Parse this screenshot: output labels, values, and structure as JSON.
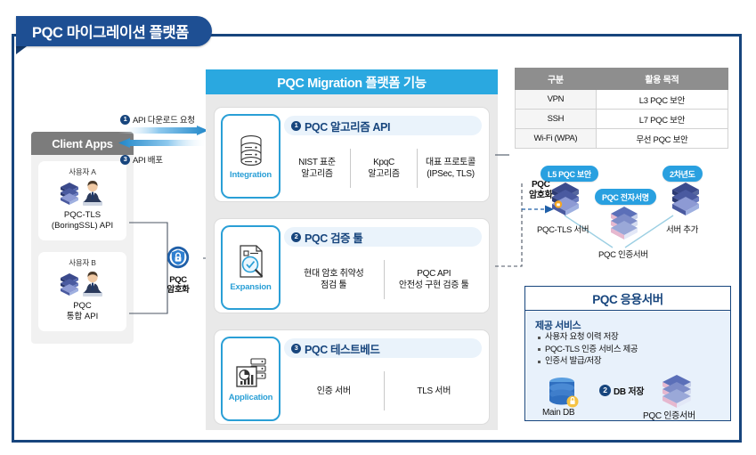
{
  "title": "PQC 마이그레이션 플랫폼",
  "client_apps": {
    "header": "Client Apps",
    "cards": [
      {
        "user": "사용자 A",
        "name_line1": "PQC-TLS",
        "name_line2": "(BoringSSL) API"
      },
      {
        "user": "사용자 B",
        "name_line1": "PQC",
        "name_line2": "통합 API"
      }
    ]
  },
  "flow_arrows": {
    "download_num": "1",
    "download_label": "API 다운로드 요청",
    "deploy_num": "3",
    "deploy_label": "API 배포"
  },
  "lock_node": {
    "icon": "lock-shield-icon",
    "line1": "PQC",
    "line2": "암호화"
  },
  "platform": {
    "header": "PQC Migration 플랫폼 기능",
    "features": [
      {
        "num": "1",
        "title": "PQC 알고리즘 API",
        "icon_caption": "Integration",
        "icon": "database-stack-icon",
        "columns": [
          {
            "line1": "NIST 표준",
            "line2": "알고리즘"
          },
          {
            "line1": "KpqC",
            "line2": "알고리즘"
          },
          {
            "line1": "대표 프로토콜",
            "line2": "(IPSec, TLS)"
          }
        ]
      },
      {
        "num": "2",
        "title": "PQC 검증 툴",
        "icon_caption": "Expansion",
        "icon": "document-magnifier-icon",
        "columns": [
          {
            "line1": "현대 암호 취약성",
            "line2": "점검 툴"
          },
          {
            "line1": "PQC API",
            "line2": "안전성 구현 검증 툴"
          }
        ]
      },
      {
        "num": "3",
        "title": "PQC 테스트베드",
        "icon_caption": "Application",
        "icon": "analytics-chart-icon",
        "columns": [
          {
            "line1": "인증 서버",
            "line2": ""
          },
          {
            "line1": "TLS 서버",
            "line2": ""
          }
        ]
      }
    ]
  },
  "usage_table": {
    "headers": [
      "구분",
      "활용 목적"
    ],
    "rows": [
      [
        "VPN",
        "L3 PQC 보안"
      ],
      [
        "SSH",
        "L7 PQC 보안"
      ],
      [
        "Wi-Fi (WPA)",
        "무선 PQC 보안"
      ]
    ]
  },
  "server_group": {
    "enc_line1": "PQC",
    "enc_line2": "암호화",
    "badge_l5": "L5 PQC 보안",
    "badge_sign": "PQC 전자서명",
    "badge_year2": "2차년도",
    "label_tls": "PQC-TLS 서버",
    "label_cert": "PQC 인증서버",
    "label_add": "서버 추가"
  },
  "app_server": {
    "title": "PQC 응용서버",
    "services_title": "제공 서비스",
    "services": [
      "사용자 요청 이력 저장",
      "PQC-TLS 인증 서비스 제공",
      "인증서 발급/저장"
    ],
    "db_num": "2",
    "db_label": "DB 저장",
    "main_db_label": "Main DB",
    "cert_server_label": "PQC 인증서버"
  },
  "colors": {
    "frame_border": "#17457d",
    "title_bg": "#1e4f93",
    "platform_header": "#2aa8e0",
    "accent_blue": "#29a0e0",
    "table_header": "#8e8e8e",
    "panel_bg": "#e8f1fb"
  }
}
